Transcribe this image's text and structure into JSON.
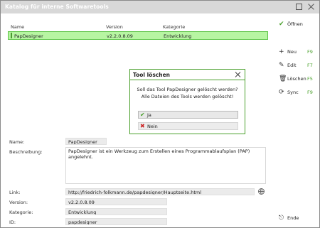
{
  "window": {
    "title": "Katalog für interne Softwaretools"
  },
  "grid": {
    "columns": [
      "Name",
      "Version",
      "Kategorie"
    ],
    "rows": [
      {
        "name": "PapDesigner",
        "version": "v2.2.0.8.09",
        "kategorie": "Entwicklung"
      }
    ]
  },
  "details": {
    "name_label": "Name:",
    "name_value": "PapDesigner",
    "beschreibung_label": "Beschreibung:",
    "beschreibung_value": "PapDesigner ist ein Werkzeug zum Erstellen eines Programmablaufsplan (PAP) angelehnt.",
    "link_label": "Link:",
    "link_value": "http://friedrich-folkmann.de/papdesigner/Hauptseite.html",
    "version_label": "Version:",
    "version_value": "v2.2.0.8.09",
    "kategorie_label": "Kategorie:",
    "kategorie_value": "Entwicklung",
    "id_label": "ID:",
    "id_value": "papdesigner"
  },
  "sidebar": {
    "offnen": "Öffnen",
    "neu": "Neu",
    "neu_key": "F9",
    "edit": "Edit",
    "edit_key": "F7",
    "loeschen": "Löschen",
    "loeschen_key": "F5",
    "sync": "Sync",
    "sync_key": "F9",
    "ende": "Ende"
  },
  "dialog": {
    "title": "Tool löschen",
    "line1": "Soll das Tool PapDesigner gelöscht werden?",
    "line2": "Alle Dateien des Tools werden gelöscht!",
    "yes": "Ja",
    "no": "Nein"
  },
  "colors": {
    "accent": "#4aa02c",
    "selection": "#b7f5a2",
    "danger": "#cc2222"
  }
}
